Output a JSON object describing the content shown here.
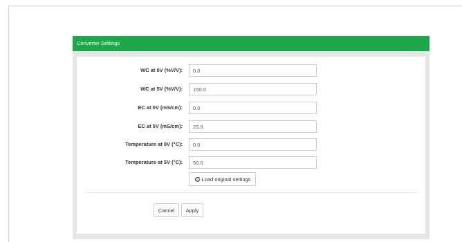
{
  "panel": {
    "title": "Converter Settings",
    "header_color": "#1da64a"
  },
  "fields": [
    {
      "label": "WC at 0V (%V/V):",
      "value": "0.0"
    },
    {
      "label": "WC at 5V (%V/V):",
      "value": "150.0"
    },
    {
      "label": "EC at 0V (mS/cm):",
      "value": "0.0"
    },
    {
      "label": "EC at 5V (mS/cm):",
      "value": "20.0"
    },
    {
      "label": "Temperature at 0V (°C):",
      "value": "0.0"
    },
    {
      "label": "Temperature at 5V (°C):",
      "value": "50.0"
    }
  ],
  "actions": {
    "load_original_label": "Load original settings",
    "load_original_icon": "refresh-icon",
    "cancel_label": "Cancel",
    "apply_label": "Apply"
  }
}
